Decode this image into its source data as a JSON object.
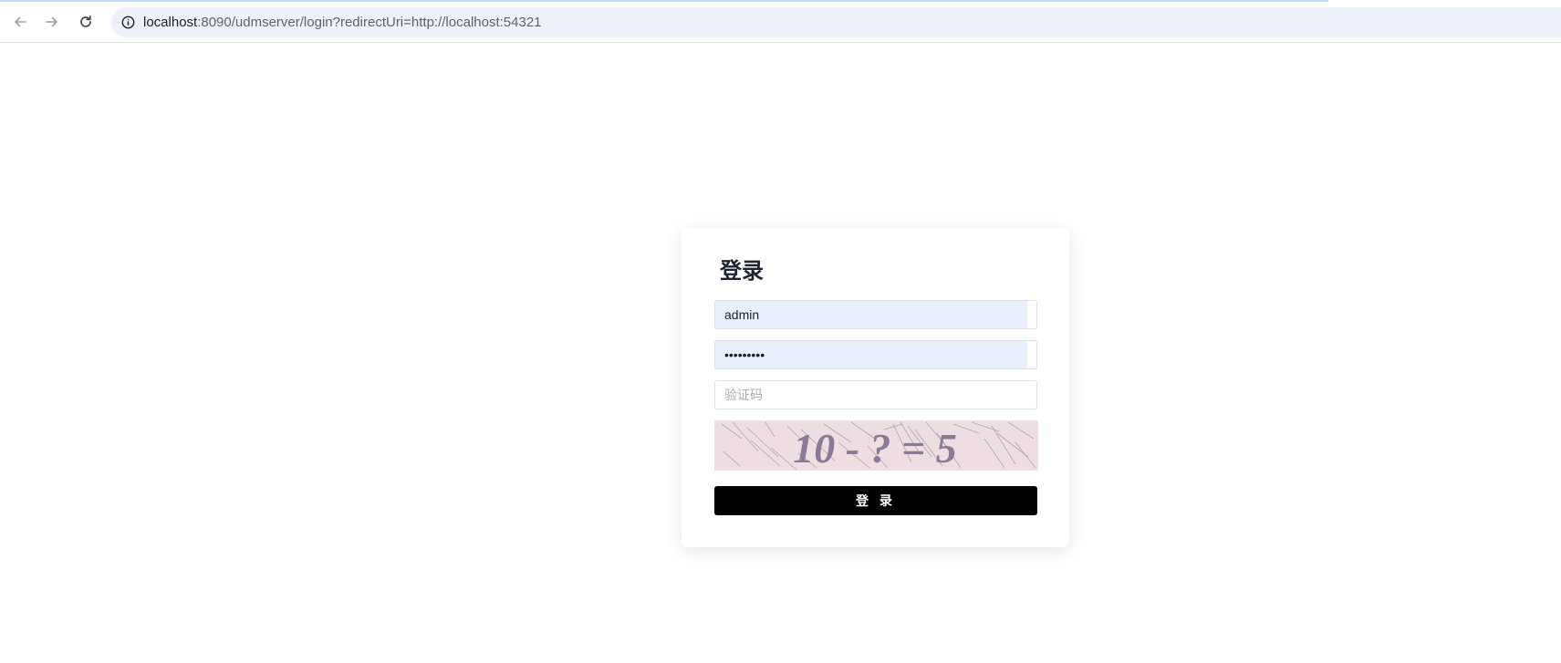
{
  "browser": {
    "url_host": "localhost",
    "url_rest": ":8090/udmserver/login?redirectUri=http://localhost:54321",
    "icons": {
      "back": "arrow-left-icon",
      "forward": "arrow-right-icon",
      "reload": "reload-icon",
      "site_info": "info-icon"
    }
  },
  "login": {
    "title": "登录",
    "username_value": "admin",
    "password_value": "123456789",
    "captcha_placeholder": "验证码",
    "captcha_text": "10 - ? = 5",
    "submit_label": "登 录"
  },
  "colors": {
    "button": "#000000",
    "autofill": "#e8f0fe",
    "captcha_bg": "#eedde1",
    "title": "#1d2331"
  }
}
